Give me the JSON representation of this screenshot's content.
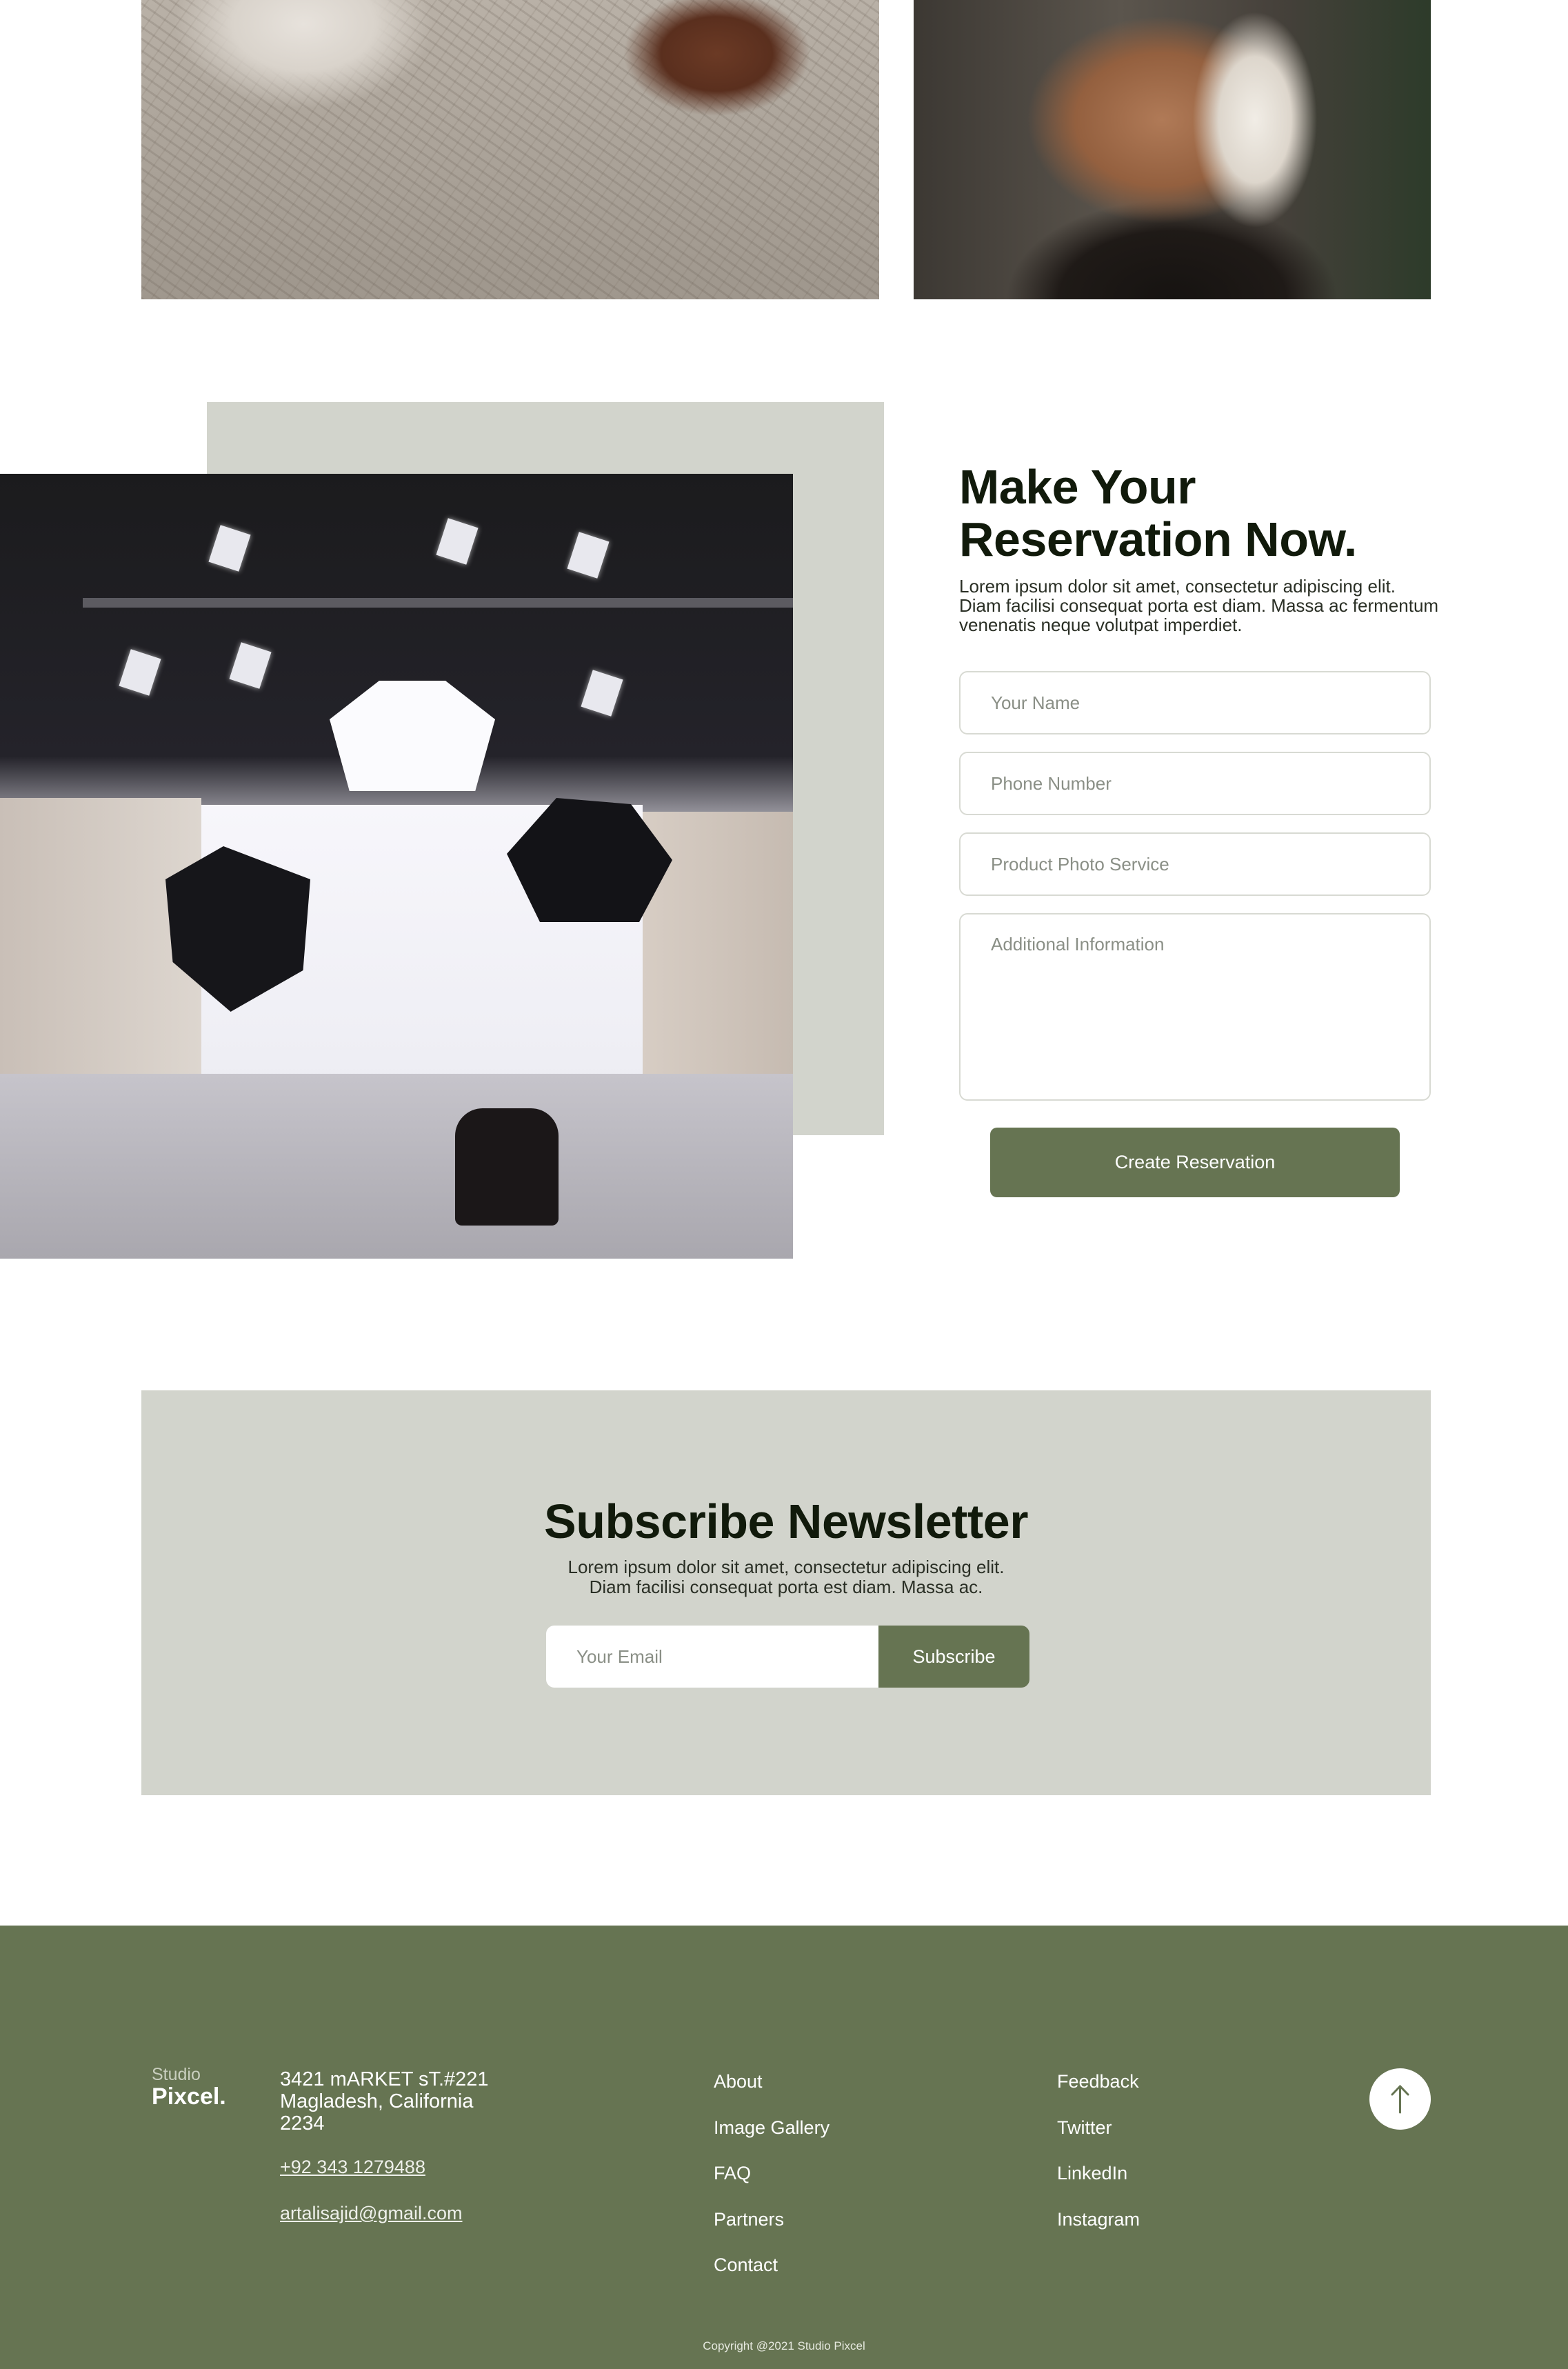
{
  "gallery": {
    "photo_left": "sand-boots-photo",
    "photo_right": "necklace-portrait-photo"
  },
  "reservation": {
    "title_line1": "Make Your",
    "title_line2": "Reservation Now.",
    "description": "Lorem ipsum dolor sit amet, consectetur adipiscing elit. Diam facilisi consequat porta est diam. Massa ac fermentum venenatis neque volutpat imperdiet.",
    "fields": {
      "name_placeholder": "Your Name",
      "phone_placeholder": "Phone Number",
      "service_placeholder": "Product Photo Service",
      "info_placeholder": "Additional Information"
    },
    "submit_label": "Create Reservation"
  },
  "newsletter": {
    "title": "Subscribe Newsletter",
    "description_line1": "Lorem ipsum dolor sit amet, consectetur adipiscing elit.",
    "description_line2": "Diam facilisi consequat porta est diam. Massa ac.",
    "email_placeholder": "Your Email",
    "button_label": "Subscribe"
  },
  "footer": {
    "logo_small": "Studio",
    "logo_big": "Pixcel.",
    "address_line1": "3421 mARKET sT.#221",
    "address_line2": "Magladesh, California",
    "address_line3": "2234",
    "phone": "+92 343 1279488",
    "email": "artalisajid@gmail.com",
    "links_col1": [
      "About",
      "Image Gallery",
      "FAQ",
      "Partners",
      "Contact"
    ],
    "links_col2": [
      "Feedback",
      "Twitter",
      "LinkedIn",
      "Instagram"
    ],
    "copyright": "Copyright @2021 Studio Pixcel"
  },
  "colors": {
    "accent": "#667452",
    "sage": "#d2d4cc",
    "heading": "#111a0b"
  },
  "icons": {
    "scroll_top": "arrow-up-icon"
  }
}
